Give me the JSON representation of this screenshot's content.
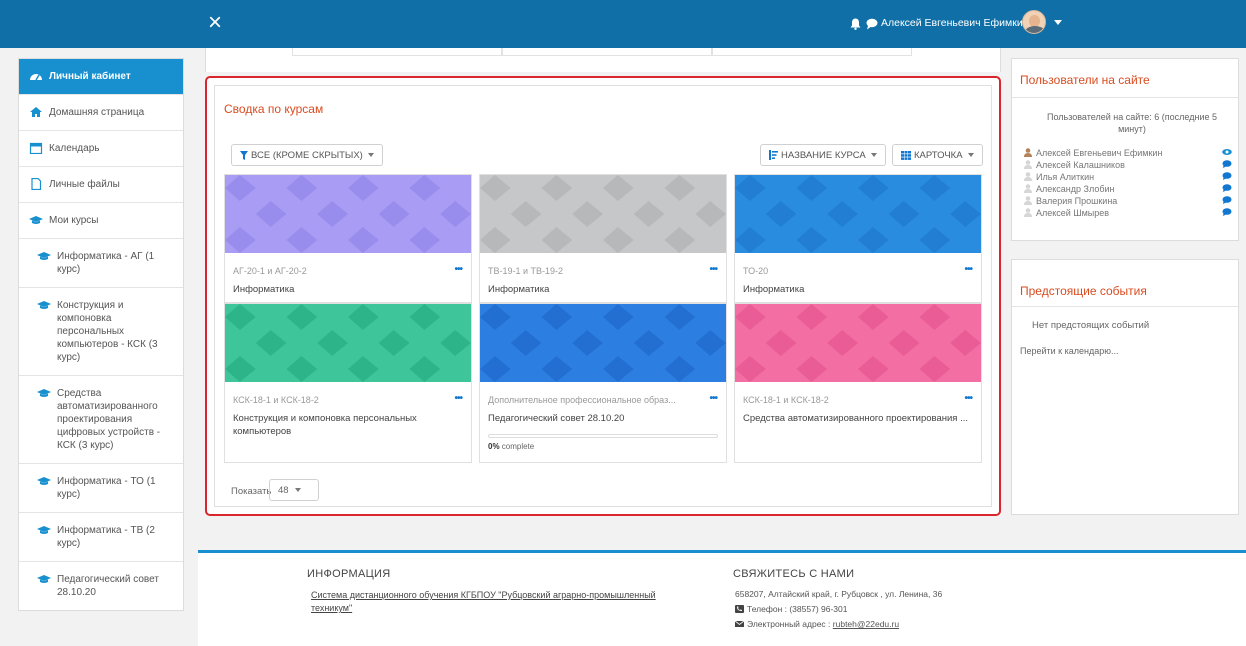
{
  "header": {
    "close_icon": "×",
    "user_name": "Алексей Евгеньевич Ефимкин"
  },
  "drawer": {
    "items": [
      {
        "label": "Личный кабинет",
        "icon": "dashboard-icon"
      },
      {
        "label": "Домашняя страница",
        "icon": "home-icon"
      },
      {
        "label": "Календарь",
        "icon": "calendar-icon"
      },
      {
        "label": "Личные файлы",
        "icon": "file-icon"
      },
      {
        "label": "Мои курсы",
        "icon": "graduation-cap-icon"
      },
      {
        "label": "Информатика - АГ (1 курс)",
        "icon": "graduation-cap-icon"
      },
      {
        "label": "Конструкция и компоновка персональных компьютеров - КСК (3 курс)",
        "icon": "graduation-cap-icon"
      },
      {
        "label": "Средства автоматизированного проектирования цифровых устройств - КСК (3 курс)",
        "icon": "graduation-cap-icon"
      },
      {
        "label": "Информатика - ТО (1 курс)",
        "icon": "graduation-cap-icon"
      },
      {
        "label": "Информатика - ТВ (2 курс)",
        "icon": "graduation-cap-icon"
      },
      {
        "label": "Педагогический совет 28.10.20",
        "icon": "graduation-cap-icon"
      }
    ]
  },
  "overview": {
    "title": "Сводка по курсам",
    "filter_label": "ВСЕ (КРОМЕ СКРЫТЫХ)",
    "sort_label": "НАЗВАНИЕ КУРСА",
    "view_label": "КАРТОЧКА",
    "courses": [
      {
        "category": "АГ-20-1 и АГ-20-2",
        "name": "Информатика",
        "colors": [
          "#a99cf4",
          "#8a7fe6"
        ]
      },
      {
        "category": "ТВ-19-1 и ТВ-19-2",
        "name": "Информатика",
        "colors": [
          "#c5c7c8",
          "#a9acae"
        ]
      },
      {
        "category": "ТО-20",
        "name": "Информатика",
        "colors": [
          "#2a8cdf",
          "#1a73c9"
        ]
      },
      {
        "category": "КСК-18-1 и КСК-18-2",
        "name": "Конструкция и компоновка персональных компьютеров",
        "colors": [
          "#3fc59a",
          "#1fa77c"
        ]
      },
      {
        "category": "Дополнительное профессиональное образ...",
        "name": "Педагогический совет 28.10.20",
        "colors": [
          "#2c7fe0",
          "#1b63c4"
        ],
        "progress": "0%",
        "progress_suffix": "complete"
      },
      {
        "category": "КСК-18-1 и КСК-18-2",
        "name": "Средства автоматизированного проектирования ...",
        "colors": [
          "#f26ea3",
          "#e24f8c"
        ]
      }
    ],
    "more_icon": "•••",
    "show_label": "Показать",
    "show_value": "48"
  },
  "online_users": {
    "title": "Пользователи на сайте",
    "count_text": "Пользователей на сайте: 6 (последние 5 минут)",
    "users": [
      "Алексей Евгеньевич Ефимкин",
      "Алексей Калашников",
      "Илья Алиткин",
      "Александр Злобин",
      "Валерия Прошкина",
      "Алексей Шмырев"
    ]
  },
  "events": {
    "title": "Предстоящие события",
    "none_text": "Нет предстоящих событий",
    "calendar_link": "Перейти к календарю..."
  },
  "footer": {
    "info_title": "ИНФОРМАЦИЯ",
    "info_link": "Система дистанционного обучения КГБПОУ \"Рубцовский аграрно-промышленный техникум\"",
    "contact_title": "СВЯЖИТЕСЬ С НАМИ",
    "address": "658207, Алтайский край, г. Рубцовск , ул. Ленина, 36",
    "phone_label": "Телефон : (38557) 96-301",
    "email_label": "Электронный адрес :",
    "email": "rubteh@22edu.ru"
  },
  "colors": {
    "navbar": "#0f6fa6",
    "accent": "#1890d0",
    "highlight_border": "#d9262e",
    "block_title": "#d84c20"
  }
}
